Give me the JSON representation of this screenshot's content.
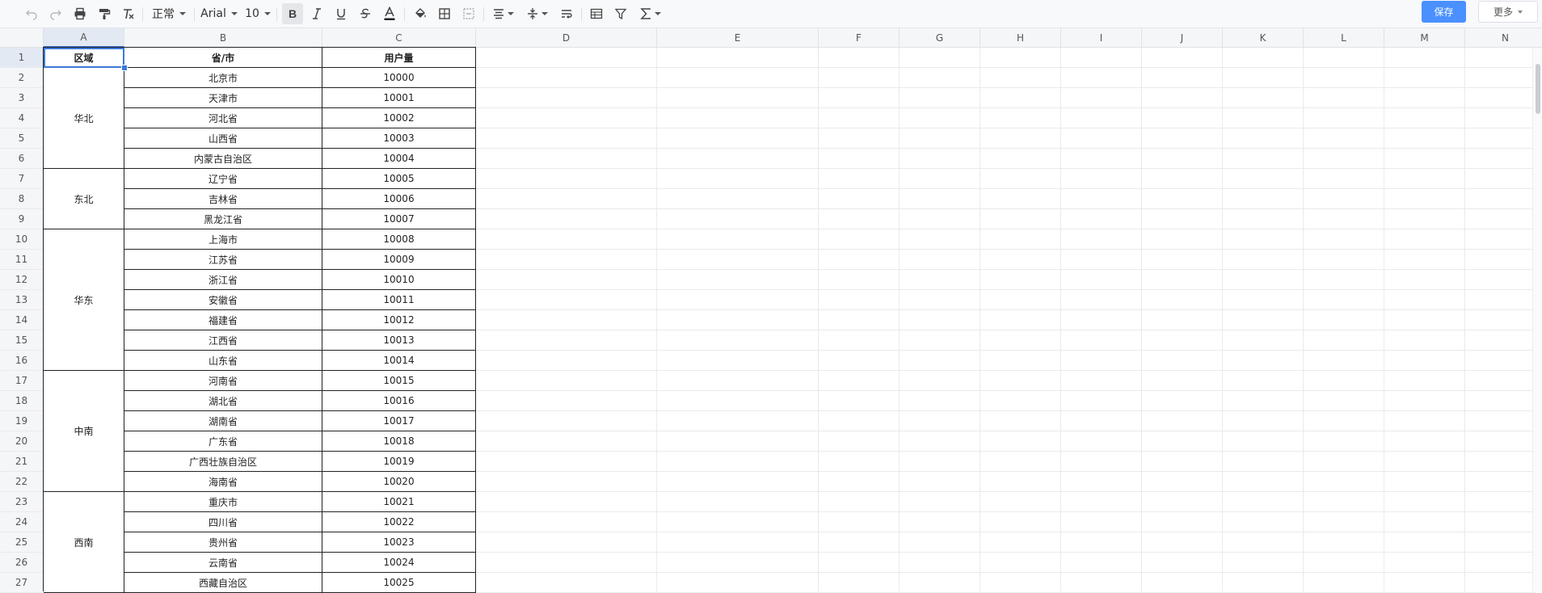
{
  "toolbar": {
    "style_select": "正常",
    "font_select": "Arial",
    "size_select": "10",
    "save_label": "保存",
    "more_label": "更多"
  },
  "sheet": {
    "columns": [
      "A",
      "B",
      "C",
      "D",
      "E",
      "F",
      "G",
      "H",
      "I",
      "J",
      "K",
      "L",
      "M",
      "N"
    ],
    "rows": [
      "1",
      "2",
      "3",
      "4",
      "5",
      "6",
      "7",
      "8",
      "9",
      "10",
      "11",
      "12",
      "13",
      "14",
      "15",
      "16",
      "17",
      "18",
      "19",
      "20",
      "21",
      "22",
      "23",
      "24",
      "25",
      "26",
      "27"
    ],
    "selected_cell": "A1",
    "headers": {
      "region": "区域",
      "province": "省/市",
      "users": "用户量"
    },
    "regions": [
      {
        "name": "华北",
        "rows": [
          {
            "province": "北京市",
            "users": "10000"
          },
          {
            "province": "天津市",
            "users": "10001"
          },
          {
            "province": "河北省",
            "users": "10002"
          },
          {
            "province": "山西省",
            "users": "10003"
          },
          {
            "province": "内蒙古自治区",
            "users": "10004"
          }
        ]
      },
      {
        "name": "东北",
        "rows": [
          {
            "province": "辽宁省",
            "users": "10005"
          },
          {
            "province": "吉林省",
            "users": "10006"
          },
          {
            "province": "黑龙江省",
            "users": "10007"
          }
        ]
      },
      {
        "name": "华东",
        "rows": [
          {
            "province": "上海市",
            "users": "10008"
          },
          {
            "province": "江苏省",
            "users": "10009"
          },
          {
            "province": "浙江省",
            "users": "10010"
          },
          {
            "province": "安徽省",
            "users": "10011"
          },
          {
            "province": "福建省",
            "users": "10012"
          },
          {
            "province": "江西省",
            "users": "10013"
          },
          {
            "province": "山东省",
            "users": "10014"
          }
        ]
      },
      {
        "name": "中南",
        "rows": [
          {
            "province": "河南省",
            "users": "10015"
          },
          {
            "province": "湖北省",
            "users": "10016"
          },
          {
            "province": "湖南省",
            "users": "10017"
          },
          {
            "province": "广东省",
            "users": "10018"
          },
          {
            "province": "广西壮族自治区",
            "users": "10019"
          },
          {
            "province": "海南省",
            "users": "10020"
          }
        ]
      },
      {
        "name": "西南",
        "rows": [
          {
            "province": "重庆市",
            "users": "10021"
          },
          {
            "province": "四川省",
            "users": "10022"
          },
          {
            "province": "贵州省",
            "users": "10023"
          },
          {
            "province": "云南省",
            "users": "10024"
          },
          {
            "province": "西藏自治区",
            "users": "10025"
          }
        ]
      }
    ]
  }
}
